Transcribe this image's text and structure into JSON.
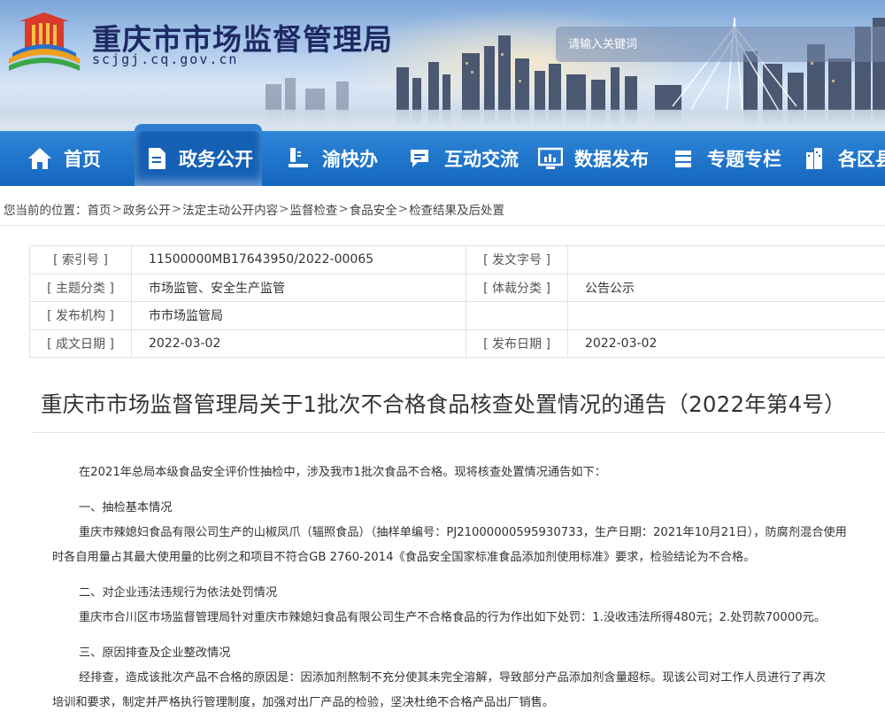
{
  "header": {
    "site_name": "重庆市市场监督管理局",
    "site_domain": "scjgj.cq.gov.cn",
    "search_placeholder": "请输入关键词"
  },
  "nav": {
    "items": [
      {
        "label": "首页",
        "icon": "home-icon"
      },
      {
        "label": "政务公开",
        "icon": "document-icon",
        "active": true
      },
      {
        "label": "渝快办",
        "icon": "service-desk-icon"
      },
      {
        "label": "互动交流",
        "icon": "chat-icon"
      },
      {
        "label": "数据发布",
        "icon": "monitor-chart-icon"
      },
      {
        "label": "专题专栏",
        "icon": "stack-icon"
      },
      {
        "label": "各区县",
        "icon": "buildings-icon"
      }
    ]
  },
  "breadcrumb": {
    "prefix": "您当前的位置：",
    "items": [
      "首页",
      "政务公开",
      "法定主动公开内容",
      "监督检查",
      "食品安全",
      "检查结果及后处置"
    ],
    "sep": ">"
  },
  "meta": {
    "rows": [
      {
        "k1": "[ 索引号 ]",
        "v1": "11500000MB17643950/2022-00065",
        "k2": "[ 发文字号 ]",
        "v2": ""
      },
      {
        "k1": "[ 主题分类 ]",
        "v1": "市场监管、安全生产监管",
        "k2": "[ 体裁分类 ]",
        "v2": "公告公示"
      },
      {
        "k1": "[ 发布机构 ]",
        "v1": "市市场监管局",
        "k2": "",
        "v2": ""
      },
      {
        "k1": "[ 成文日期 ]",
        "v1": "2022-03-02",
        "k2": "[ 发布日期 ]",
        "v2": "2022-03-02"
      }
    ]
  },
  "article": {
    "title": "重庆市市场监督管理局关于1批次不合格食品核查处置情况的通告（2022年第4号）",
    "intro": "在2021年总局本级食品安全评价性抽检中，涉及我市1批次食品不合格。现将核查处置情况通告如下：",
    "s1_heading": "一、抽检基本情况",
    "s1_line1": "重庆市辣媳妇食品有限公司生产的山椒凤爪（辐照食品）（抽样单编号：PJ21000000595930733，生产日期：2021年10月21日），防腐剂混合使用",
    "s1_line2": "时各自用量占其最大使用量的比例之和项目不符合GB 2760-2014《食品安全国家标准食品添加剂使用标准》要求，检验结论为不合格。",
    "s2_heading": "二、对企业违法违规行为依法处罚情况",
    "s2_line1": "重庆市合川区市场监督管理局针对重庆市辣媳妇食品有限公司生产不合格食品的行为作出如下处罚：1.没收违法所得480元；2.处罚款70000元。",
    "s3_heading": "三、原因排查及企业整改情况",
    "s3_line1": "经排查，造成该批次产品不合格的原因是：因添加剂熬制不充分使其未完全溶解，导致部分产品添加剂含量超标。现该公司对工作人员进行了再次",
    "s3_line2": "培训和要求，制定并严格执行管理制度，加强对出厂产品的检验，坚决杜绝不合格产品出厂销售。"
  }
}
